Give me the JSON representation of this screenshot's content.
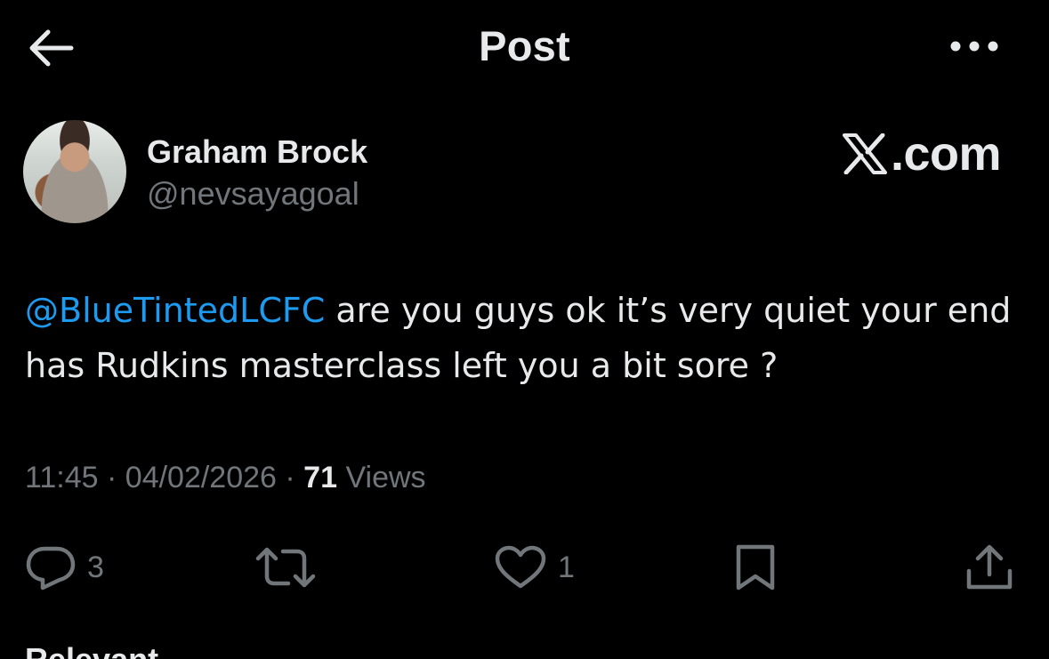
{
  "header": {
    "title": "Post"
  },
  "author": {
    "name": "Graham Brock",
    "handle": "@nevsayagoal"
  },
  "source_logo_text": ".com",
  "post": {
    "mention": "@BlueTintedLCFC",
    "text": " are you guys ok it’s very quiet your end  has Rudkins masterclass left you a bit sore ?"
  },
  "meta": {
    "time": "11:45",
    "date": "04/02/2026",
    "separator": " · ",
    "views_count": "71",
    "views_label": " Views"
  },
  "actions": {
    "reply_count": "3",
    "like_count": "1"
  },
  "next_section_partial": "Relevant",
  "colors": {
    "background": "#000000",
    "text_primary": "#e7e9ea",
    "text_secondary": "#71767b",
    "accent": "#1d9bf0"
  },
  "icons": [
    "back-arrow-icon",
    "more-icon",
    "x-logo-icon",
    "reply-icon",
    "repost-icon",
    "like-icon",
    "bookmark-icon",
    "share-icon"
  ]
}
